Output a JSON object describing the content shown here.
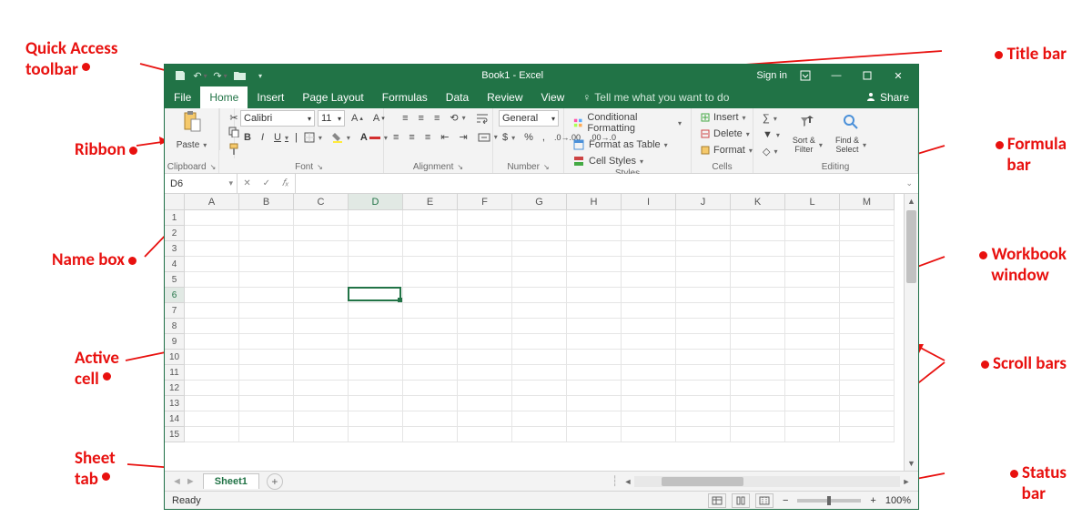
{
  "callouts": {
    "quick_access": "Quick Access\ntoolbar",
    "title_bar": "Title bar",
    "ribbon": "Ribbon",
    "formula_bar": "Formula\nbar",
    "name_box": "Name box",
    "workbook_window": "Workbook\nwindow",
    "active_cell": "Active\ncell",
    "scroll_bars": "Scroll bars",
    "sheet_tab": "Sheet\ntab",
    "status_bar": "Status\nbar"
  },
  "title": {
    "app_title": "Book1 - Excel",
    "sign_in": "Sign in"
  },
  "tabs": {
    "file": "File",
    "home": "Home",
    "insert": "Insert",
    "page_layout": "Page Layout",
    "formulas": "Formulas",
    "data": "Data",
    "review": "Review",
    "view": "View",
    "tell_me": "Tell me what you want to do",
    "share": "Share"
  },
  "ribbon": {
    "clipboard": {
      "label": "Clipboard",
      "paste": "Paste"
    },
    "font": {
      "label": "Font",
      "name": "Calibri",
      "size": "11",
      "bold": "B",
      "italic": "I",
      "underline": "U"
    },
    "alignment": {
      "label": "Alignment"
    },
    "number": {
      "label": "Number",
      "format": "General",
      "currency": "$",
      "percent": "%",
      "comma": ","
    },
    "styles": {
      "label": "Styles",
      "cond": "Conditional Formatting",
      "table": "Format as Table",
      "cell": "Cell Styles"
    },
    "cells": {
      "label": "Cells",
      "insert": "Insert",
      "delete": "Delete",
      "format": "Format"
    },
    "editing": {
      "label": "Editing",
      "sort": "Sort &\nFilter",
      "find": "Find &\nSelect"
    }
  },
  "namebox": {
    "value": "D6"
  },
  "fx": {
    "label": "𝑓ₓ",
    "x": "✕",
    "check": "✓"
  },
  "columns": [
    "A",
    "B",
    "C",
    "D",
    "E",
    "F",
    "G",
    "H",
    "I",
    "J",
    "K",
    "L",
    "M"
  ],
  "rows": [
    "1",
    "2",
    "3",
    "4",
    "5",
    "6",
    "7",
    "8",
    "9",
    "10",
    "11",
    "12",
    "13",
    "14",
    "15"
  ],
  "active": {
    "col": "D",
    "row": "6",
    "colIndex": 3,
    "rowIndex": 5
  },
  "sheets": {
    "sheet1": "Sheet1",
    "add": "+"
  },
  "status": {
    "ready": "Ready",
    "zoom": "100%",
    "minus": "−",
    "plus": "+"
  }
}
